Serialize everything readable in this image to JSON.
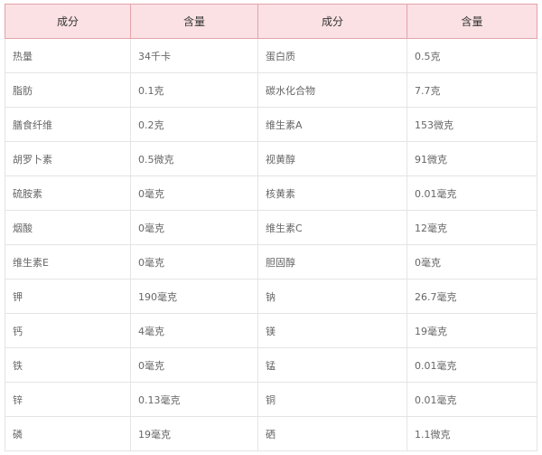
{
  "headers": [
    "成分",
    "含量",
    "成分",
    "含量"
  ],
  "rows": [
    [
      "热量",
      "34千卡",
      "蛋白质",
      "0.5克"
    ],
    [
      "脂肪",
      "0.1克",
      "碳水化合物",
      "7.7克"
    ],
    [
      "膳食纤维",
      "0.2克",
      "维生素A",
      "153微克"
    ],
    [
      "胡罗卜素",
      "0.5微克",
      "视黄醇",
      "91微克"
    ],
    [
      "硫胺素",
      "0毫克",
      "核黄素",
      "0.01毫克"
    ],
    [
      "烟酸",
      "0毫克",
      "维生素C",
      "12毫克"
    ],
    [
      "维生素E",
      "0毫克",
      "胆固醇",
      "0毫克"
    ],
    [
      "钾",
      "190毫克",
      "钠",
      "26.7毫克"
    ],
    [
      "钙",
      "4毫克",
      "镁",
      "19毫克"
    ],
    [
      "铁",
      "0毫克",
      "锰",
      "0.01毫克"
    ],
    [
      "锌",
      "0.13毫克",
      "铜",
      "0.01毫克"
    ],
    [
      "磷",
      "19毫克",
      "硒",
      "1.1微克"
    ]
  ],
  "colors": {
    "header_bg": "#fbe1e3",
    "header_border": "#e3a3ab",
    "cell_border": "#e4e4e4",
    "cell_text": "#666666"
  }
}
